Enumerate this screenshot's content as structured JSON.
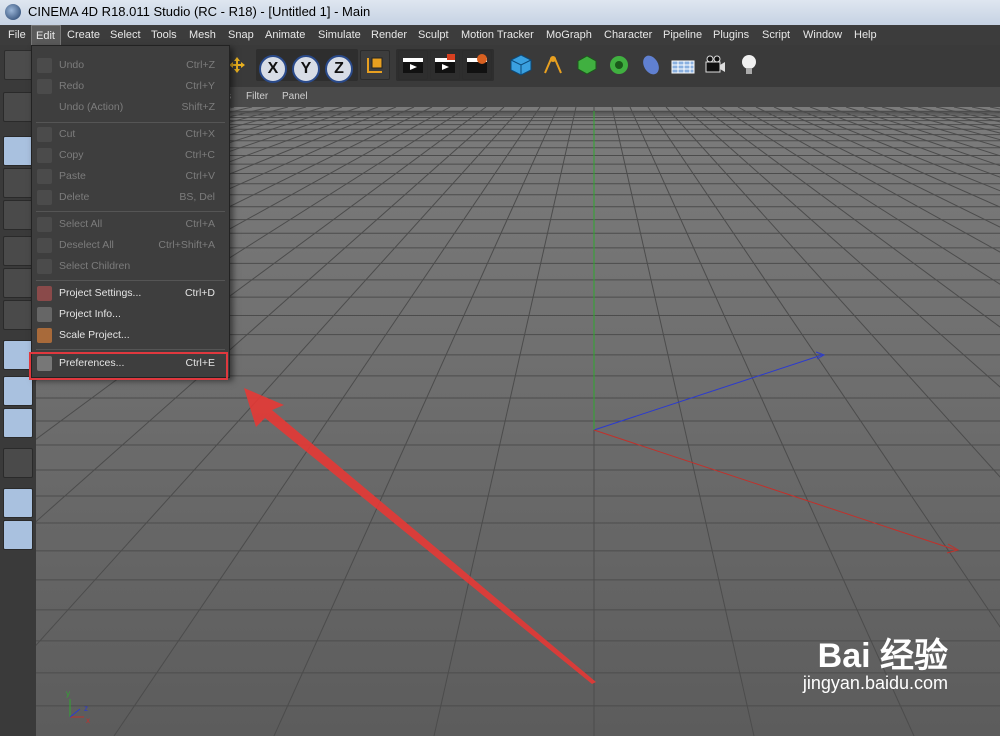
{
  "window": {
    "title": "CINEMA 4D R18.011 Studio (RC - R18) - [Untitled 1] - Main"
  },
  "menubar": {
    "items": [
      "File",
      "Edit",
      "Create",
      "Select",
      "Tools",
      "Mesh",
      "Snap",
      "Animate",
      "Simulate",
      "Render",
      "Sculpt",
      "Motion Tracker",
      "MoGraph",
      "Character",
      "Pipeline",
      "Plugins",
      "Script",
      "Window",
      "Help"
    ],
    "active": "Edit"
  },
  "toolbar": {
    "axis_buttons": [
      "X",
      "Y",
      "Z"
    ],
    "icons": [
      "undo-icon",
      "move-icon",
      "coordinate-system-icon",
      "render-view-icon",
      "render-picture-viewer-icon",
      "render-settings-icon",
      "cube-icon",
      "pen-icon",
      "subdivision-icon",
      "cloner-icon",
      "deformer-icon",
      "floor-icon",
      "camera-icon",
      "light-icon"
    ]
  },
  "viewport_menu": {
    "items": [
      "s",
      "Filter",
      "Panel"
    ]
  },
  "edit_menu": {
    "items": [
      {
        "label": "Undo",
        "shortcut": "Ctrl+Z",
        "enabled": false,
        "icon": "undo-icon"
      },
      {
        "label": "Redo",
        "shortcut": "Ctrl+Y",
        "enabled": false,
        "icon": "redo-icon"
      },
      {
        "label": "Undo (Action)",
        "shortcut": "Shift+Z",
        "enabled": false,
        "icon": ""
      },
      {
        "label": "Cut",
        "shortcut": "Ctrl+X",
        "enabled": false,
        "icon": "cut-icon"
      },
      {
        "label": "Copy",
        "shortcut": "Ctrl+C",
        "enabled": false,
        "icon": "copy-icon"
      },
      {
        "label": "Paste",
        "shortcut": "Ctrl+V",
        "enabled": false,
        "icon": "paste-icon"
      },
      {
        "label": "Delete",
        "shortcut": "BS, Del",
        "enabled": false,
        "icon": "delete-icon"
      },
      {
        "label": "Select All",
        "shortcut": "Ctrl+A",
        "enabled": false,
        "icon": "select-all-icon"
      },
      {
        "label": "Deselect All",
        "shortcut": "Ctrl+Shift+A",
        "enabled": false,
        "icon": "deselect-all-icon"
      },
      {
        "label": "Select Children",
        "shortcut": "",
        "enabled": false,
        "icon": "select-children-icon"
      },
      {
        "label": "Project Settings...",
        "shortcut": "Ctrl+D",
        "enabled": true,
        "icon": "project-settings-icon"
      },
      {
        "label": "Project Info...",
        "shortcut": "",
        "enabled": true,
        "icon": "project-info-icon"
      },
      {
        "label": "Scale Project...",
        "shortcut": "",
        "enabled": true,
        "icon": "scale-project-icon"
      },
      {
        "label": "Preferences...",
        "shortcut": "Ctrl+E",
        "enabled": true,
        "icon": "preferences-icon"
      }
    ]
  },
  "axis_gizmo": {
    "y": "y",
    "z": "z",
    "x": "x"
  },
  "watermark": {
    "logo": "Bai  经验",
    "url": "jingyan.baidu.com"
  },
  "colors": {
    "highlight_box": "#e0383e",
    "axis_x": "#c0312b",
    "axis_y": "#2fa82f",
    "axis_z": "#2b3ad0"
  }
}
